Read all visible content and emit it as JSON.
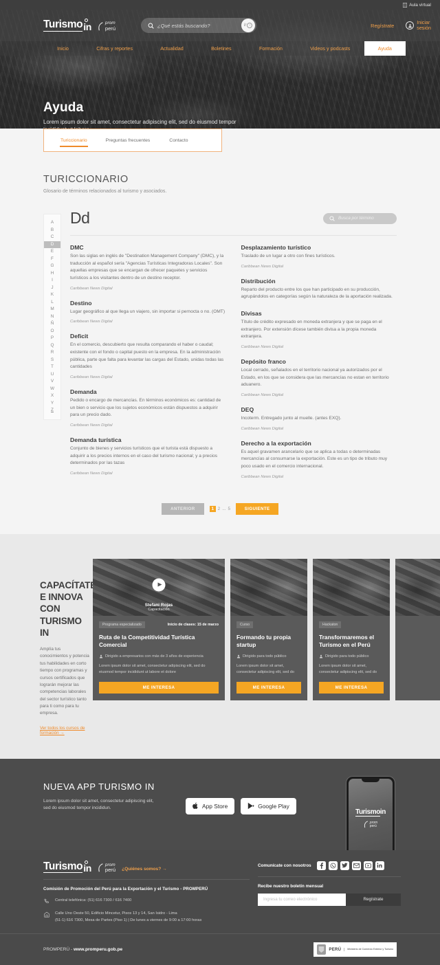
{
  "utility": {
    "aula_virtual": "Aula virtual",
    "book_icon": "book-icon"
  },
  "header": {
    "brand": {
      "word": "Turismo",
      "suffix": "in",
      "promperu_line1": "prom",
      "promperu_line2": "perú"
    },
    "search": {
      "placeholder": "¿Qué estás buscando?",
      "value": "",
      "go_label": "Ir",
      "icon": "search-icon"
    },
    "register": "Regístrate",
    "login_line1": "Iniciar",
    "login_line2": "sesión",
    "nav": [
      {
        "label": "Inicio",
        "active": false
      },
      {
        "label": "Cifras y reportes",
        "active": false
      },
      {
        "label": "Actualidad",
        "active": false
      },
      {
        "label": "Boletines",
        "active": false
      },
      {
        "label": "Formación",
        "active": false
      },
      {
        "label": "Videos y podcasts",
        "active": false
      },
      {
        "label": "Ayuda",
        "active": true
      }
    ]
  },
  "hero": {
    "title": "Ayuda",
    "subtitle": "Lorem ipsum dolor sit amet, consectetur adipiscing elit, sed do eiusmod tempor incididunt ut labore"
  },
  "tabs": [
    {
      "label": "Turiccionario",
      "active": true
    },
    {
      "label": "Preguntas frecuentes",
      "active": false
    },
    {
      "label": "Contacto",
      "active": false
    }
  ],
  "section": {
    "title": "TURICCIONARIO",
    "description": "Glosario de términos relacionados al turismo y asociados."
  },
  "glossary": {
    "alphabet": [
      "A",
      "B",
      "C",
      "D",
      "E",
      "F",
      "G",
      "H",
      "I",
      "J",
      "K",
      "L",
      "M",
      "N",
      "Ñ",
      "O",
      "P",
      "Q",
      "R",
      "S",
      "T",
      "U",
      "V",
      "W",
      "X",
      "Y",
      "Z"
    ],
    "active_letter": "D",
    "letter_heading": "Dd",
    "term_search_placeholder": "Busca por término",
    "term_search_value": "",
    "columns": [
      [
        {
          "term": "DMC",
          "definition": "Son las siglas en inglés de \"Destination Management Company\" (DMC), y la traducción al español sería \"Agencias Turísticas Integradoras Locales\". Son aquellas empresas que se encargan de ofrecer paquetes y servicios turísticos a los visitantes dentro de un destino receptor.",
          "source": "Caribbean News Digital"
        },
        {
          "term": "Destino",
          "definition": "Lugar geográfico al que llega un viajero, sin importar si pernocta o no. (OMT)",
          "source": "Caribbean News Digital"
        },
        {
          "term": "Deficit",
          "definition": "En el comercio, descubierto que resulta comparando el haber o caudal; existente con el fondo o capital puesto en la empresa. En la administración pública, parte que falta para levantar las cargas del Estado, unidas todas las cantidades",
          "source": "Caribbean News Digital"
        },
        {
          "term": "Demanda",
          "definition": "Pedido o encargo de mercancías. En términos económicos es: cantidad de un bien o servicio que los sujetos económicos están dispuestos a adquirir para un precio dado.",
          "source": "Caribbean News Digital"
        },
        {
          "term": "Demanda turística",
          "definition": "Conjunto de bienes y servicios turísticos que el turista está dispuesto a adquirir a los precios internos en el caso del turismo nacional; y a precios determinados por las tazas",
          "source": "Caribbean News Digital"
        }
      ],
      [
        {
          "term": "Desplazamiento turístico",
          "definition": "Traslado de un lugar a otro con fines turísticos.",
          "source": "Caribbean News Digital"
        },
        {
          "term": "Distribución",
          "definition": "Reparto del producto entre los que han participado en su producción, agrupándolos en categorías según la naturaleza de la aportación realizada.",
          "source": ""
        },
        {
          "term": "Divisas",
          "definition": "Título de crédito expresado en moneda extranjera y que se paga en el extranjero. Por extensión dícese también divisa a la propia moneda extranjera.",
          "source": "Caribbean News Digital"
        },
        {
          "term": "Depósito franco",
          "definition": "Local cerrado, señalados en el territorio nacional ya autorizados por el Estado, en los que se considera que las mercancías no estan en territorio aduanero.",
          "source": "Caribbean News Digital"
        },
        {
          "term": "DEQ",
          "definition": "Incoterm. Entregado junto al muelle. (antes EXQ).",
          "source": "Caribbean News Digital"
        },
        {
          "term": "Derecho a la exportación",
          "definition": "Es aquel gravamen arancelario que se aplica a todas o determinadas mercancías al consumarse la exportación. Este es un tipo de tributo muy poco usado en el comercio internacional.",
          "source": "Caribbean News Digital"
        }
      ]
    ]
  },
  "pagination": {
    "prev": "ANTERIOR",
    "next": "SIGUIENTE",
    "pages": [
      "1",
      "2",
      "...",
      "5"
    ],
    "current": "1"
  },
  "courses": {
    "title": "CAPACÍTATE E INNOVA CON TURISMO IN",
    "text": "Amplía tus conocimientos y potencia tus habilidades en corto tiempo con programas y cursos certificados que lograrán mejorar las competencias laborales del sector turístico tanto para ti como para tu empresa.",
    "link": "Ver todos los cursos de formación →",
    "featured": {
      "speaker_name": "Stefani Rojas",
      "speaker_role": "Capacitación",
      "play_icon": "play-icon"
    },
    "cards": [
      {
        "chip": "Programa especializado",
        "date": "Inicio de clases: 15 de marzo",
        "title": "Ruta de la Competitividad Turística Comercial",
        "audience": "Dirigido a empresarios con más de 3 años de experiencia",
        "description": "Lorem ipsum dolor sit amet, consectetur adipiscing elit, sed do eiusmod tempor incididunt ut labore et dolore",
        "cta": "ME INTERESA"
      },
      {
        "chip": "Curso",
        "date": "",
        "title": "Formando tu propia startup",
        "audience": "Dirigido para todo público",
        "description": "Lorem ipsum dolor sit amet, consectetur adipiscing elit, sed do",
        "cta": "ME INTERESA"
      },
      {
        "chip": "Hackaton",
        "date": "",
        "title": "Transformaremos el Turismo en el Perú",
        "audience": "Dirigido para todo público",
        "description": "Lorem ipsum dolor sit amet, consectetur adipiscing elit, sed do",
        "cta": "ME INTERESA"
      }
    ]
  },
  "app": {
    "title": "NUEVA APP TURISMO IN",
    "text": "Lorem ipsum dolor sit amet, consectetur adipiscing elit, sed do eiusmod tempor incididun.",
    "appstore": "App Store",
    "googleplay": "Google Play",
    "phone_brand": "Turismo",
    "phone_brand_suffix": "in"
  },
  "footer": {
    "brand_word": "Turismo",
    "brand_suffix": "in",
    "promperu_line1": "prom",
    "promperu_line2": "perú",
    "quienes_somos": "¿Quiénes somos?  →",
    "organization": "Comisión de Promoción del Perú para la Exportación y el Turismo - PROMPERÚ",
    "phone_label": "Central telefónica: (51) 616 7300 / 616 7400",
    "address_line1": "Calle Uno Oeste 50, Edificio Mincetur, Pisos 13 y 14, San Isidro - Lima",
    "address_line2": "(51-1) 616 7300, Mesa de Partes (Piso 1) | De lunes a viernes de 9:00 a 17:00 horas",
    "social_label": "Comunícate con nosotros",
    "social": [
      "facebook-icon",
      "whatsapp-icon",
      "twitter-icon",
      "email-icon",
      "youtube-icon",
      "linkedin-icon"
    ],
    "newsletter_label": "Recibe nuestro boletín mensual",
    "newsletter_placeholder": "Ingresa tu correo electrónico",
    "newsletter_value": "",
    "newsletter_button": "Regístrate",
    "bottom_prefix": "PROMPERÚ - ",
    "bottom_site": "www.promperu.gob.pe",
    "gov_peru": "PERÚ",
    "gov_ministry": "Ministerio de Comercio Exterior y Turismo"
  },
  "colors": {
    "accent_orange": "#ef8a29",
    "cta_orange": "#f5a623",
    "dark_gray": "#4a4a4a",
    "page_bg": "#f4f4f4"
  }
}
